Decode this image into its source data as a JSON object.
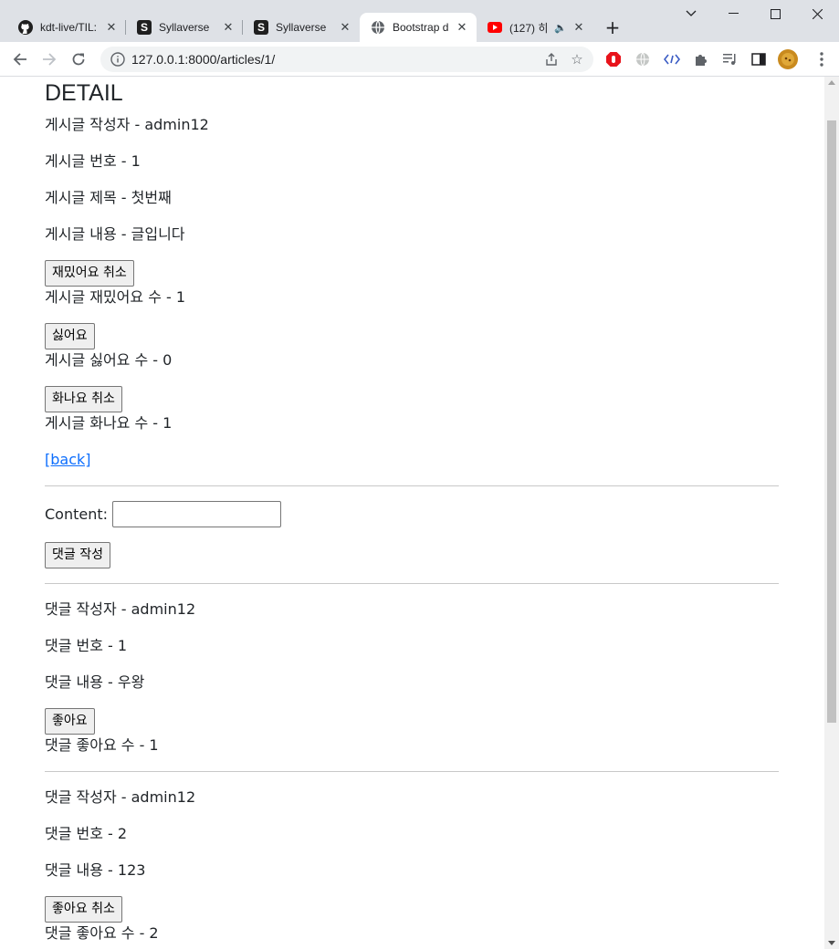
{
  "browser": {
    "tabs": [
      {
        "title": "kdt-live/TIL:",
        "icon": "github-icon"
      },
      {
        "title": "Syllaverse",
        "icon": "syllaverse-icon"
      },
      {
        "title": "Syllaverse",
        "icon": "syllaverse-icon"
      },
      {
        "title": "Bootstrap d",
        "icon": "globe-icon"
      },
      {
        "title": "(127) 히",
        "icon": "youtube-icon"
      }
    ],
    "url": "127.0.0.1:8000/articles/1/",
    "window_controls": {
      "minimize": "—",
      "maximize": "☐",
      "close": "✕"
    }
  },
  "article": {
    "heading": "DETAIL",
    "author": "게시글 작성자 - admin12",
    "number": "게시글 번호 - 1",
    "title": "게시글 제목 - 첫번째",
    "content": "게시글 내용 - 글입니다",
    "fun_button": "재밌어요 취소",
    "fun_count": "게시글 재밌어요 수 - 1",
    "dislike_button": "싫어요",
    "dislike_count": "게시글 싫어요 수 - 0",
    "angry_button": "화나요 취소",
    "angry_count": "게시글 화나요 수 - 1",
    "back_link": "[back]"
  },
  "comment_form": {
    "label": "Content:",
    "value": "",
    "submit": "댓글 작성"
  },
  "comments": [
    {
      "author": "댓글 작성자 - admin12",
      "number": "댓글 번호 - 1",
      "content": "댓글 내용 - 우왕",
      "like_button": "좋아요",
      "like_count": "댓글 좋아요 수 - 1"
    },
    {
      "author": "댓글 작성자 - admin12",
      "number": "댓글 번호 - 2",
      "content": "댓글 내용 - 123",
      "like_button": "좋아요 취소",
      "like_count": "댓글 좋아요 수 - 2"
    }
  ]
}
